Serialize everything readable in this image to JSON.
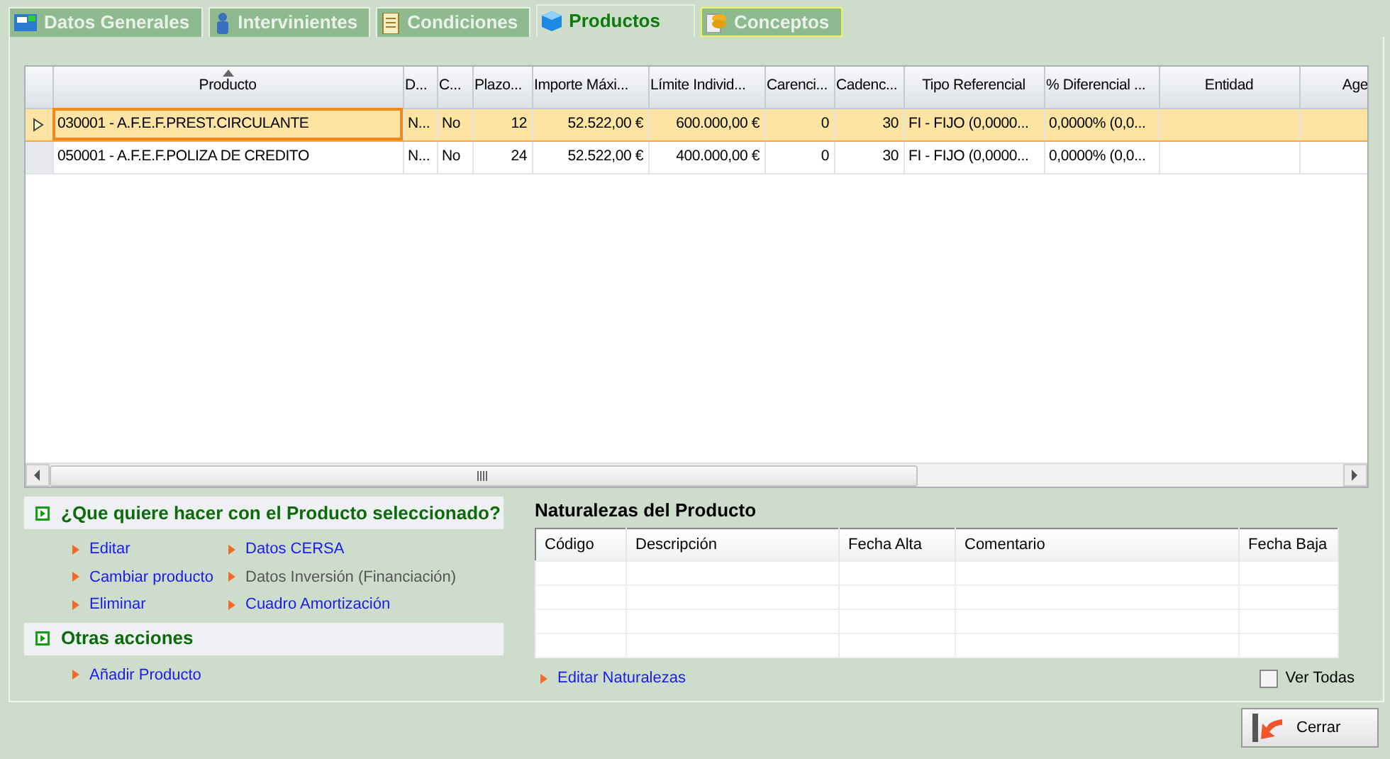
{
  "tabs": [
    {
      "label": "Datos Generales",
      "selected": false,
      "focused": false
    },
    {
      "label": "Intervinientes",
      "selected": false,
      "focused": false
    },
    {
      "label": "Condiciones",
      "selected": false,
      "focused": false
    },
    {
      "label": "Productos",
      "selected": true,
      "focused": false
    },
    {
      "label": "Conceptos",
      "selected": false,
      "focused": true
    }
  ],
  "products_table": {
    "columns": [
      {
        "label": "Producto",
        "sorted": true
      },
      {
        "label": "D...",
        "sorted": false
      },
      {
        "label": "C...",
        "sorted": false
      },
      {
        "label": "Plazo...",
        "sorted": false
      },
      {
        "label": "Importe Máxi...",
        "sorted": false
      },
      {
        "label": "Límite Individ...",
        "sorted": false
      },
      {
        "label": "Carenci...",
        "sorted": false
      },
      {
        "label": "Cadenc...",
        "sorted": false
      },
      {
        "label": "Tipo Referencial",
        "sorted": false
      },
      {
        "label": "% Diferencial ...",
        "sorted": false
      },
      {
        "label": "Entidad",
        "sorted": false
      },
      {
        "label": "Age",
        "sorted": false
      }
    ],
    "rows": [
      {
        "selected": true,
        "cells": [
          "030001 - A.F.E.F.PREST.CIRCULANTE",
          "N...",
          "No",
          "12",
          "52.522,00 €",
          "600.000,00 €",
          "0",
          "30",
          "FI - FIJO (0,0000...",
          "0,0000%  (0,0..."
        ]
      },
      {
        "selected": false,
        "cells": [
          "050001 - A.F.E.F.POLIZA DE CREDITO",
          "N...",
          "No",
          "24",
          "52.522,00 €",
          "400.000,00 €",
          "0",
          "30",
          "FI - FIJO (0,0000...",
          "0,0000%  (0,0..."
        ]
      }
    ]
  },
  "actions": {
    "title": "¿Que quiere hacer con el Producto seleccionado?",
    "links": [
      {
        "label": "Editar",
        "disabled": false
      },
      {
        "label": "Datos CERSA",
        "disabled": false
      },
      {
        "label": "Cambiar producto",
        "disabled": false
      },
      {
        "label": "Datos Inversión (Financiación)",
        "disabled": true
      },
      {
        "label": "Eliminar",
        "disabled": false
      },
      {
        "label": "Cuadro Amortización",
        "disabled": false
      }
    ]
  },
  "other_actions": {
    "title": "Otras acciones",
    "links": [
      {
        "label": "Añadir Producto",
        "disabled": false
      }
    ]
  },
  "naturalezas": {
    "title": "Naturalezas del Producto",
    "columns": [
      "Código",
      "Descripción",
      "Fecha Alta",
      "Comentario",
      "Fecha Baja"
    ],
    "link": "Editar Naturalezas",
    "show_all": {
      "label": "Ver Todas",
      "checked": false
    }
  },
  "close_button": "Cerrar"
}
